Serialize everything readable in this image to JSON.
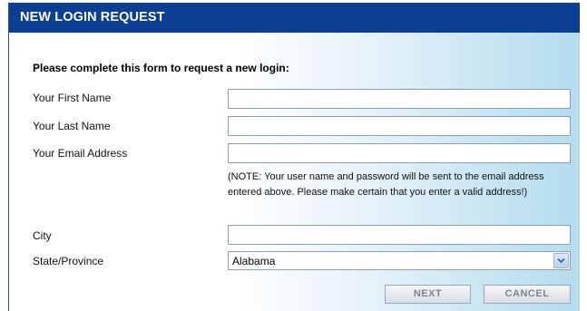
{
  "header": {
    "title": "NEW LOGIN REQUEST"
  },
  "form": {
    "intro": "Please complete this form to request a new login:",
    "fields": [
      {
        "label": "Your First Name",
        "value": ""
      },
      {
        "label": "Your Last Name",
        "value": ""
      },
      {
        "label": "Your Email Address",
        "value": ""
      }
    ],
    "note": "(NOTE: Your user name and password will be sent to the email address entered above. Please make certain that you enter a valid address!)",
    "city": {
      "label": "City",
      "value": ""
    },
    "state": {
      "label": "State/Province",
      "selected": "Alabama"
    },
    "buttons": {
      "next": "NEXT",
      "cancel": "CANCEL"
    }
  },
  "colors": {
    "header_bg": "#0b3f93",
    "button_text": "#7a8590"
  },
  "icons": {
    "dropdown": "chevron-down-icon"
  }
}
